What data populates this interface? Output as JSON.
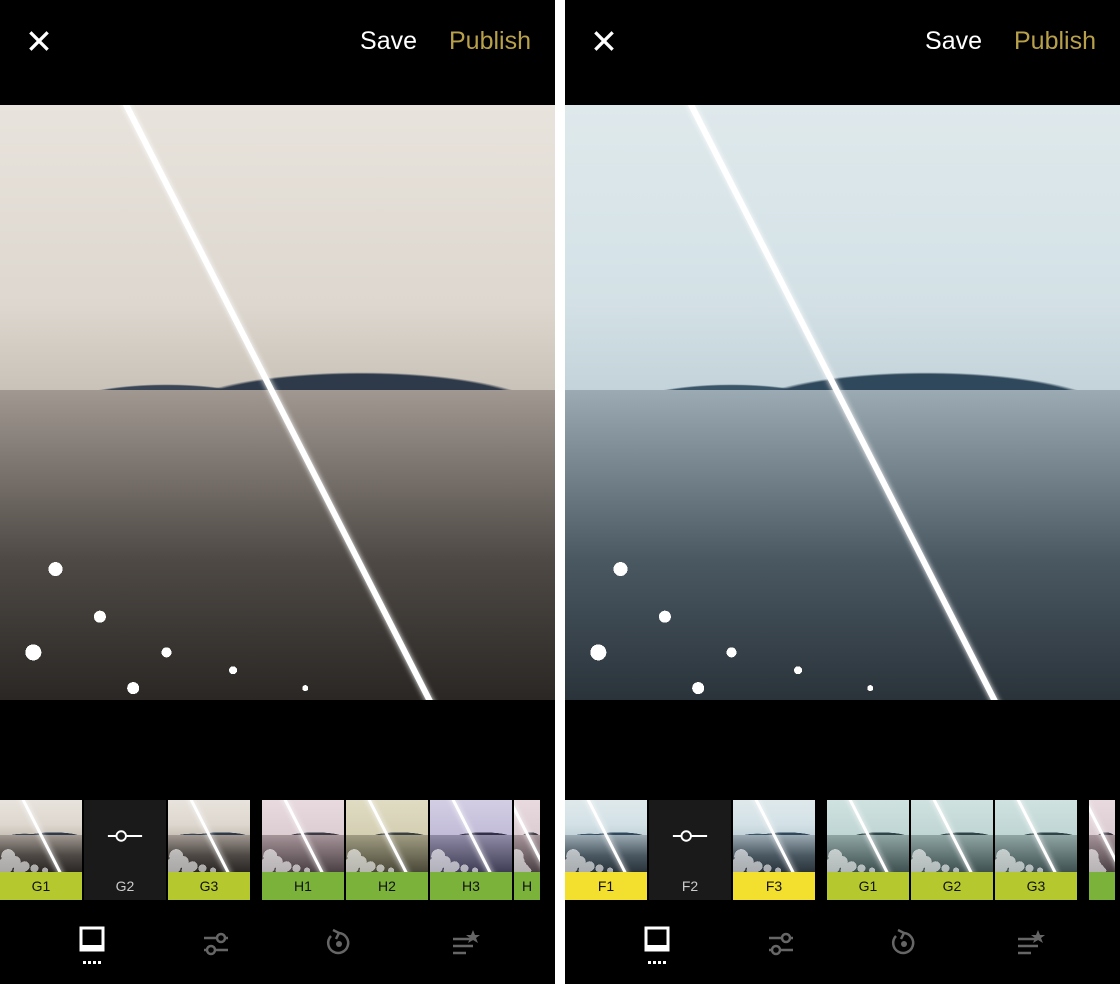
{
  "panes": [
    {
      "topbar": {
        "save_label": "Save",
        "publish_label": "Publish"
      },
      "preview_tint": "t-warm",
      "filter_groups": [
        {
          "accent": "#b5c92f",
          "items": [
            {
              "label": "G1",
              "selected": false,
              "tint": "t-warm"
            },
            {
              "label": "G2",
              "selected": true
            },
            {
              "label": "G3",
              "selected": false,
              "tint": "t-warm"
            }
          ]
        },
        {
          "accent": "#7ab23a",
          "items": [
            {
              "label": "H1",
              "selected": false,
              "tint": "t-pink"
            },
            {
              "label": "H2",
              "selected": false,
              "tint": "t-olive"
            },
            {
              "label": "H3",
              "selected": false,
              "tint": "t-violet"
            },
            {
              "label": "H",
              "selected": false,
              "tint": "t-pink",
              "partial": true
            }
          ]
        }
      ],
      "nav_active": 0
    },
    {
      "topbar": {
        "save_label": "Save",
        "publish_label": "Publish"
      },
      "preview_tint": "t-cool",
      "filter_groups": [
        {
          "accent": "#f2df2e",
          "items": [
            {
              "label": "F1",
              "selected": false,
              "tint": "t-cool"
            },
            {
              "label": "F2",
              "selected": true
            },
            {
              "label": "F3",
              "selected": false,
              "tint": "t-cool"
            }
          ]
        },
        {
          "accent": "#b5c92f",
          "items": [
            {
              "label": "G1",
              "selected": false,
              "tint": "t-teal"
            },
            {
              "label": "G2",
              "selected": false,
              "tint": "t-teal"
            },
            {
              "label": "G3",
              "selected": false,
              "tint": "t-teal"
            }
          ]
        },
        {
          "accent": "#7ab23a",
          "items": [
            {
              "label": "",
              "selected": false,
              "tint": "t-pink",
              "partial": true
            }
          ]
        }
      ],
      "nav_active": 0
    }
  ]
}
